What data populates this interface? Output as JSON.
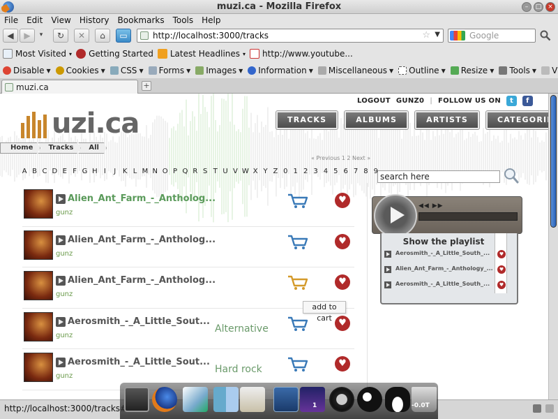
{
  "window": {
    "title": "muzi.ca - Mozilla Firefox"
  },
  "menubar": [
    "File",
    "Edit",
    "View",
    "History",
    "Bookmarks",
    "Tools",
    "Help"
  ],
  "navbar": {
    "url": "http://localhost:3000/tracks",
    "search_placeholder": "Google"
  },
  "bookmarks": [
    {
      "label": "Most Visited",
      "dropdown": true,
      "icon": "most-visited-icon"
    },
    {
      "label": "Getting Started",
      "dropdown": false,
      "icon": "getting-started-icon"
    },
    {
      "label": "Latest Headlines",
      "dropdown": true,
      "icon": "rss-icon"
    },
    {
      "label": "http://www.youtube...",
      "dropdown": false,
      "icon": "youtube-icon"
    }
  ],
  "devbar": [
    {
      "label": "Disable",
      "icon": "disable-icon"
    },
    {
      "label": "Cookies",
      "icon": "cookies-icon"
    },
    {
      "label": "CSS",
      "icon": "css-icon"
    },
    {
      "label": "Forms",
      "icon": "forms-icon"
    },
    {
      "label": "Images",
      "icon": "images-icon"
    },
    {
      "label": "Information",
      "icon": "information-icon"
    },
    {
      "label": "Miscellaneous",
      "icon": "miscellaneous-icon"
    },
    {
      "label": "Outline",
      "icon": "outline-icon"
    },
    {
      "label": "Resize",
      "icon": "resize-icon"
    },
    {
      "label": "Tools",
      "icon": "tools-icon"
    },
    {
      "label": "View S",
      "icon": "view-source-icon"
    }
  ],
  "tabs": [
    {
      "label": "muzi.ca"
    }
  ],
  "site": {
    "logo_text": "uzi.ca",
    "topbar": {
      "logout": "LOGOUT",
      "user": "GUNZ0",
      "follow": "FOLLOW US ON"
    },
    "nav": [
      "TRACKS",
      "ALBUMS",
      "ARTISTS",
      "CATEGORIES"
    ],
    "breadcrumb": [
      "Home",
      "Tracks",
      "All"
    ],
    "pagination": "« Previous 1 2 Next »",
    "alphabet": [
      "A",
      "B",
      "C",
      "D",
      "E",
      "F",
      "G",
      "H",
      "I",
      "J",
      "K",
      "L",
      "M",
      "N",
      "O",
      "P",
      "Q",
      "R",
      "S",
      "T",
      "U",
      "V",
      "W",
      "X",
      "Y",
      "Z",
      "0",
      "1",
      "2",
      "3",
      "4",
      "5",
      "6",
      "7",
      "8",
      "9"
    ],
    "search_value": "search here",
    "tooltip": "add to cart",
    "tracks": [
      {
        "name": "Alien_Ant_Farm_-_Antholog...",
        "user": "gunz",
        "genre": "",
        "cart_color": "#3a7ab8"
      },
      {
        "name": "Alien_Ant_Farm_-_Antholog...",
        "user": "gunz",
        "genre": "",
        "cart_color": "#3a7ab8"
      },
      {
        "name": "Alien_Ant_Farm_-_Antholog...",
        "user": "gunz",
        "genre": "",
        "cart_color": "#d49a2a"
      },
      {
        "name": "Aerosmith_-_A_Little_Sout...",
        "user": "gunz",
        "genre": "Alternative",
        "cart_color": "#3a7ab8"
      },
      {
        "name": "Aerosmith_-_A_Little_Sout...",
        "user": "gunz",
        "genre": "Hard rock",
        "cart_color": "#3a7ab8"
      }
    ],
    "player": {
      "playlist_title": "Show the playlist"
    },
    "playlist": [
      {
        "title": "Aerosmith_-_A_Little_South_..."
      },
      {
        "title": "Alien_Ant_Farm_-_Anthology_..."
      },
      {
        "title": "Aerosmith_-_A_Little_South_..."
      }
    ]
  },
  "statusbar": {
    "url": "http://localhost:3000/tracks#"
  },
  "dock": {
    "workspace_badge": "1",
    "trash_label": "-0.0T"
  }
}
